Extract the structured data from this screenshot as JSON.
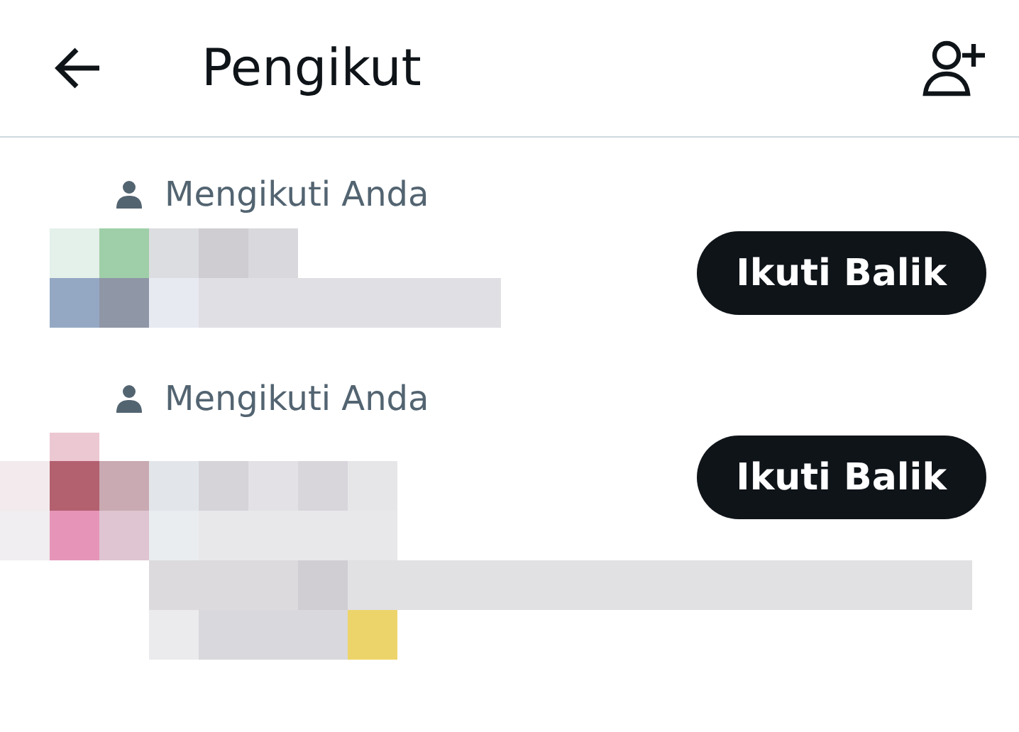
{
  "header": {
    "title": "Pengikut"
  },
  "followers": [
    {
      "label": "Mengikuti Anda",
      "button": "Ikuti Balik",
      "kind": "picture"
    },
    {
      "label": "Mengikuti Anda",
      "button": "Ikuti Balik",
      "kind": "picture"
    }
  ]
}
